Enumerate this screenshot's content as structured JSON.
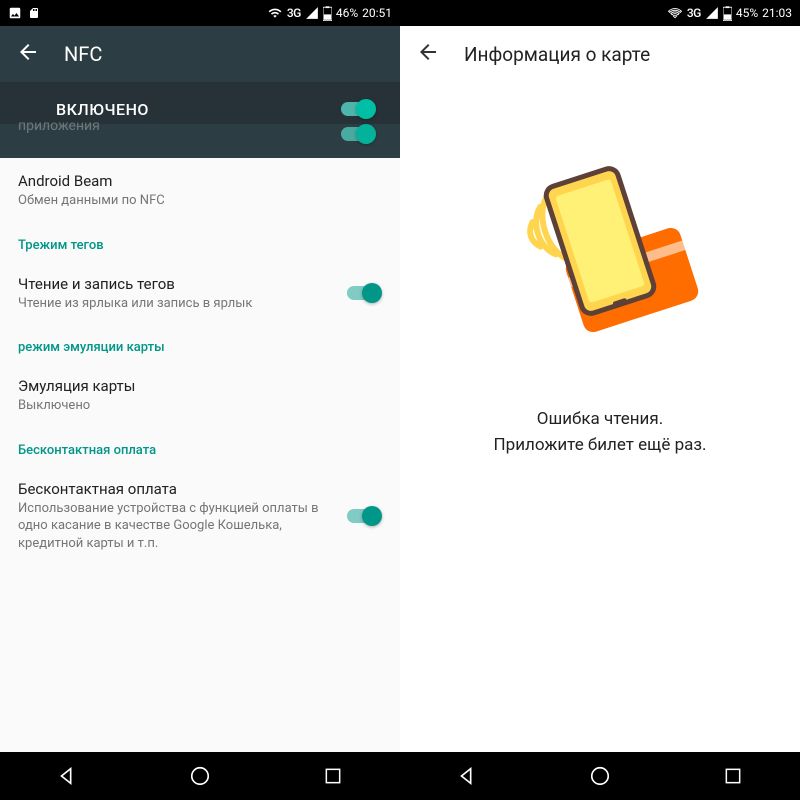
{
  "left": {
    "status": {
      "network": "3G",
      "battery": "46%",
      "time": "20:51"
    },
    "appbar": {
      "title": "NFC",
      "enabled_label": "ВКЛЮЧЕНО"
    },
    "peek": {
      "label": "приложения"
    },
    "items": {
      "beam": {
        "title": "Android Beam",
        "sub": "Обмен данными по NFC"
      },
      "section_tags": "Трежим тегов",
      "tags_rw": {
        "title": "Чтение и запись тегов",
        "sub": "Чтение из ярлыка или запись в ярлык"
      },
      "section_emul": "режим эмуляции карты",
      "emul": {
        "title": "Эмуляция карты",
        "sub": "Выключено"
      },
      "section_pay": "Бесконтактная оплата",
      "pay": {
        "title": "Бесконтактная оплата",
        "sub": "Использование устройства с функцией оплаты в одно касание в качестве Google Кошелька, кредитной карты и т.п."
      }
    }
  },
  "right": {
    "status": {
      "network": "3G",
      "battery": "45%",
      "time": "21:03"
    },
    "appbar": {
      "title": "Информация о карте"
    },
    "error": {
      "line1": "Ошибка чтения.",
      "line2": "Приложите билет ещё раз."
    }
  },
  "colors": {
    "teal": "#009688",
    "darkbar": "#2c3e44"
  }
}
